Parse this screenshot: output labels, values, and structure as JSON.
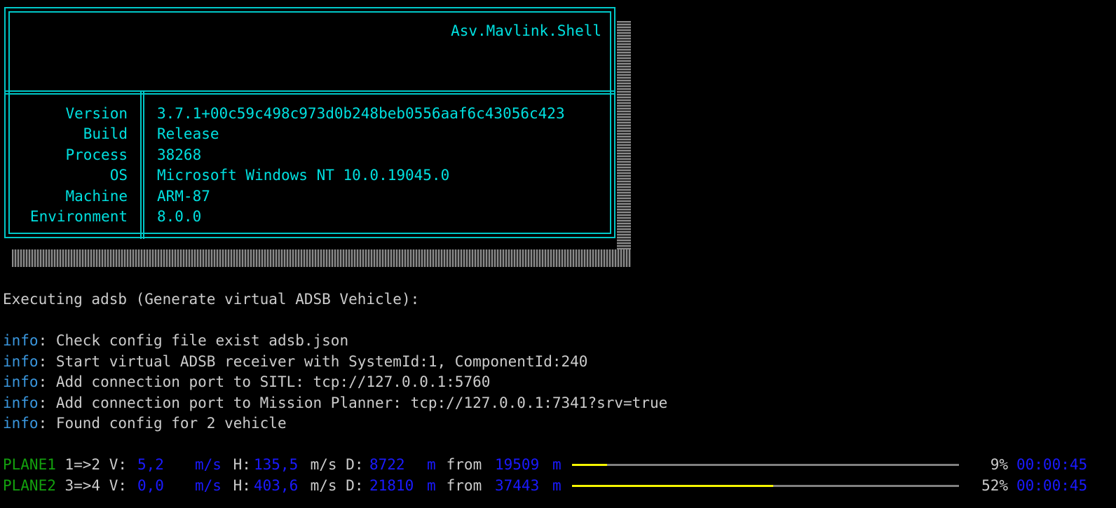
{
  "banner": {
    "title": "Asv.Mavlink.Shell",
    "rows": [
      {
        "key": "Version",
        "value": "3.7.1+00c59c498c973d0b248beb0556aaf6c43056c423"
      },
      {
        "key": "Build",
        "value": "Release"
      },
      {
        "key": "Process",
        "value": "38268"
      },
      {
        "key": "OS",
        "value": "Microsoft Windows NT 10.0.19045.0"
      },
      {
        "key": "Machine",
        "value": "ARM-87"
      },
      {
        "key": "Environment",
        "value": "8.0.0"
      }
    ]
  },
  "executing": "Executing adsb (Generate virtual ADSB Vehicle):",
  "logs": [
    {
      "level": "info",
      "text": ": Check config file exist adsb.json"
    },
    {
      "level": "info",
      "text": ": Start virtual ADSB receiver with SystemId:1, ComponentId:240"
    },
    {
      "level": "info",
      "text": ": Add connection port to SITL: tcp://127.0.0.1:5760"
    },
    {
      "level": "info",
      "text": ": Add connection port to Mission Planner: tcp://127.0.0.1:7341?srv=true"
    },
    {
      "level": "info",
      "text": ": Found config for 2 vehicle"
    }
  ],
  "planes": [
    {
      "name": "PLANE1",
      "route": " 1=>2 V:",
      "v": "5,2",
      "v_unit": "m/s",
      "h_label": " H:",
      "h": "135,5",
      "h_unit": " m/s D:",
      "d": "8722",
      "d_unit": "m",
      "from": " from ",
      "total": "19509",
      "total_unit": "m",
      "progress": 0.09,
      "percent": "9%",
      "time": "00:00:45"
    },
    {
      "name": "PLANE2",
      "route": " 3=>4 V:",
      "v": "0,0",
      "v_unit": "m/s",
      "h_label": " H:",
      "h": "403,6",
      "h_unit": " m/s D:",
      "d": "21810",
      "d_unit": "m",
      "from": " from ",
      "total": "37443",
      "total_unit": "m",
      "progress": 0.52,
      "percent": "52%",
      "time": "00:00:45"
    }
  ],
  "colors": {
    "cyan": "#00e0e0",
    "info": "#3a96dd",
    "plane": "#13a10e",
    "value_blue": "#1a1aff",
    "progress_fill": "#f5f500",
    "progress_track": "#808080"
  }
}
